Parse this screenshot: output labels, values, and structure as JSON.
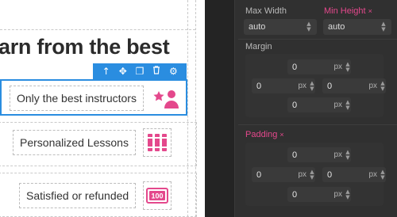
{
  "canvas": {
    "heading": "arn from the best",
    "toolbar": [
      {
        "name": "move-up-icon",
        "glyph": "↑"
      },
      {
        "name": "drag-move-icon",
        "glyph": "✥"
      },
      {
        "name": "duplicate-icon",
        "glyph": "❐"
      },
      {
        "name": "trash-icon",
        "glyph": "🗑"
      },
      {
        "name": "gear-icon",
        "glyph": "⚙"
      }
    ],
    "items": [
      {
        "label": "Only the best instructors",
        "icon": "instructor-star-icon"
      },
      {
        "label": "Personalized Lessons",
        "icon": "books-icon"
      },
      {
        "label": "Satisfied or refunded",
        "icon": "money-100-icon",
        "icon_text": "100"
      }
    ],
    "accent_color": "#e4488c",
    "selection_color": "#2a8de0"
  },
  "panel": {
    "max_width_label": "Max Width",
    "min_height_label": "Min Height",
    "max_width_value": "auto",
    "min_height_value": "auto",
    "clear_mark": "×",
    "margin_label": "Margin",
    "margin": {
      "top": "0",
      "left": "0",
      "right": "0",
      "bottom": "0"
    },
    "padding_label": "Padding",
    "padding": {
      "top": "0",
      "left": "0",
      "right": "0",
      "bottom": "0"
    },
    "unit": "px"
  }
}
